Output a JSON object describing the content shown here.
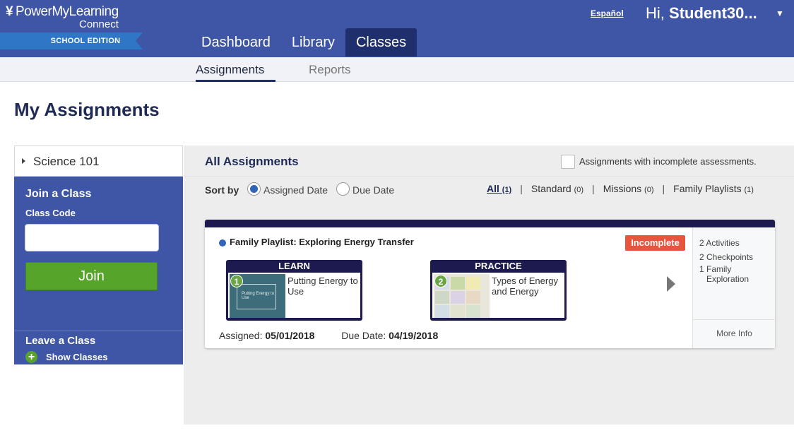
{
  "header": {
    "logo_main": "PowerMyLearning",
    "logo_sub": "Connect",
    "logo_ribbon": "SCHOOL EDITION",
    "nav": [
      {
        "label": "Dashboard"
      },
      {
        "label": "Library"
      },
      {
        "label": "Classes",
        "active": true
      }
    ],
    "language_link": "Español",
    "greeting_prefix": "Hi,",
    "user_name": "Student30..."
  },
  "subnav": {
    "tabs": [
      {
        "label": "Assignments",
        "active": true
      },
      {
        "label": "Reports"
      }
    ]
  },
  "page_title": "My Assignments",
  "left_panel": {
    "class_selected": "Science 101",
    "join_title": "Join a Class",
    "code_label": "Class Code",
    "code_value": "",
    "join_button": "Join",
    "leave_title": "Leave a Class",
    "show_classes": "Show Classes"
  },
  "main": {
    "title": "All Assignments",
    "incomplete_filter_label": "Assignments with incomplete assessments.",
    "sort_label": "Sort by",
    "sort_options": [
      {
        "label": "Assigned Date",
        "selected": true
      },
      {
        "label": "Due Date",
        "selected": false
      }
    ],
    "filters": [
      {
        "label": "All",
        "count": "(1)",
        "active": true
      },
      {
        "label": "Standard",
        "count": "(0)"
      },
      {
        "label": "Missions",
        "count": "(0)"
      },
      {
        "label": "Family Playlists",
        "count": "(1)"
      }
    ],
    "assignment": {
      "title": "Family Playlist: Exploring Energy Transfer",
      "status": "Incomplete",
      "tiles": [
        {
          "stage": "LEARN",
          "number": "1",
          "name": "Putting Energy to Use",
          "thumb_text": "Putting Energy to Use"
        },
        {
          "stage": "PRACTICE",
          "number": "2",
          "name": "Types of Energy and Energy"
        }
      ],
      "assigned_label": "Assigned:",
      "assigned_date": "05/01/2018",
      "due_label": "Due Date:",
      "due_date": "04/19/2018",
      "stats": [
        "2 Activities",
        "2 Checkpoints",
        "1 Family Exploration"
      ],
      "more_info": "More Info"
    }
  },
  "colors": {
    "header_blue": "#3f55a6",
    "nav_active": "#1f2f6e",
    "join_green": "#56a42a",
    "incomplete_red": "#e8553f",
    "card_dark": "#1c1a4f"
  }
}
